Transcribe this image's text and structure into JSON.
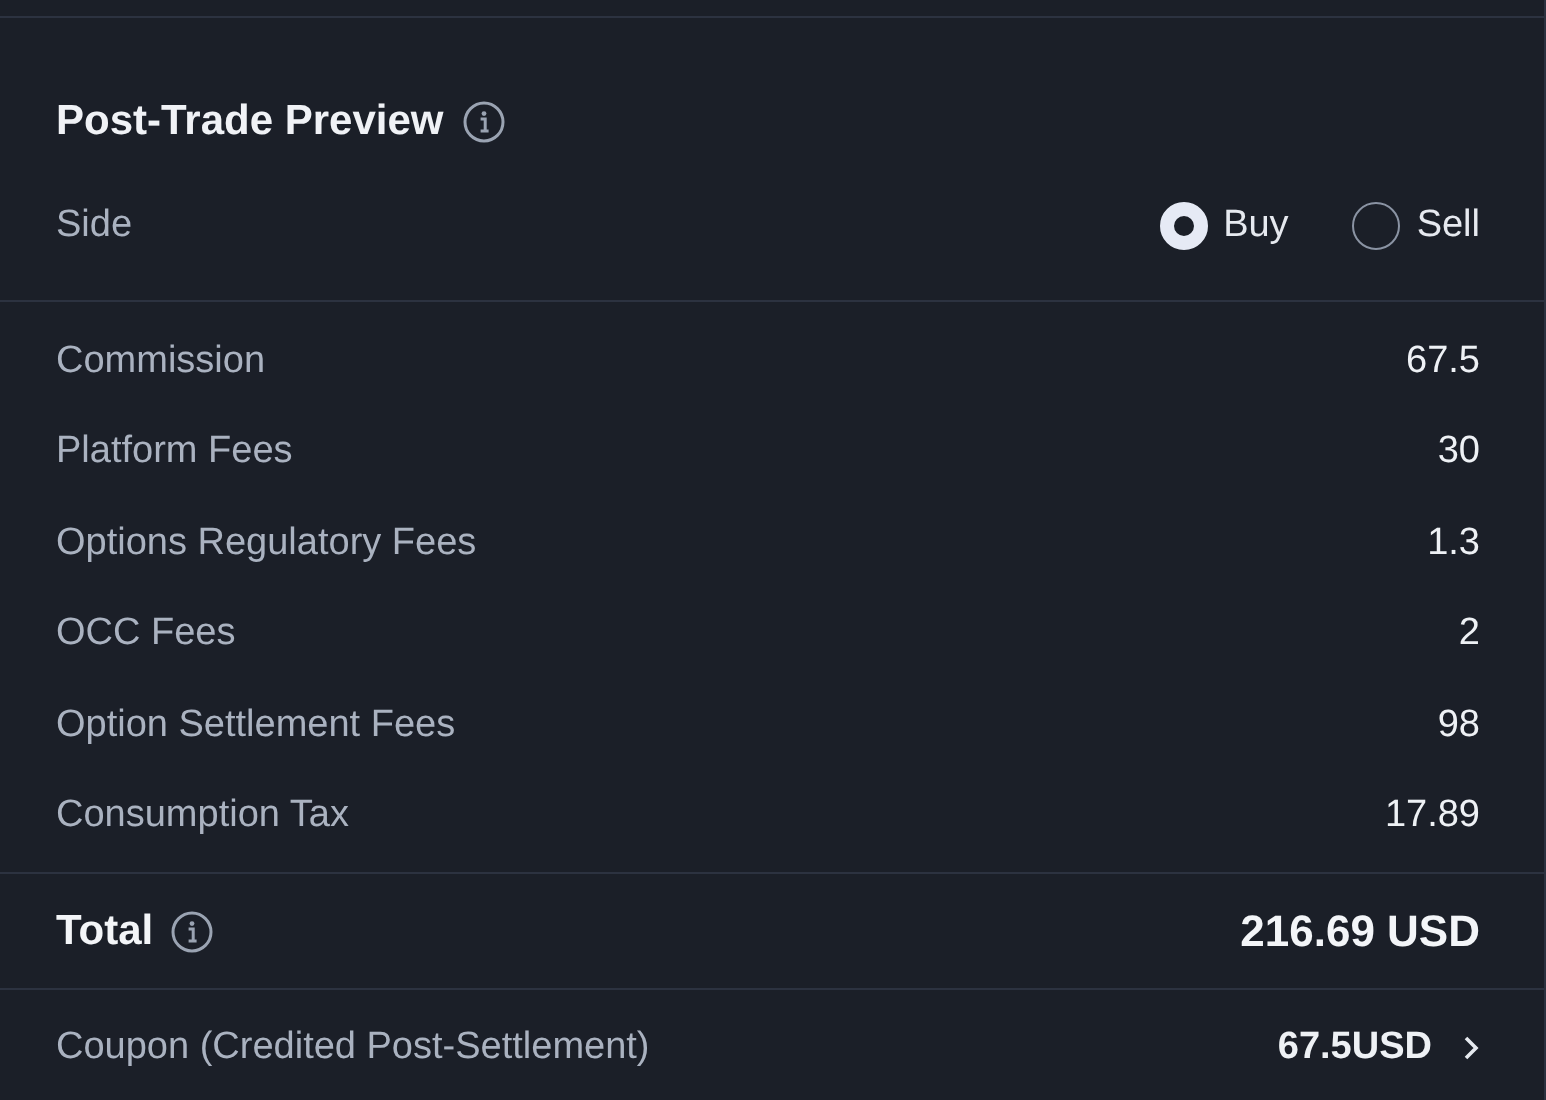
{
  "title": "Post-Trade Preview",
  "side": {
    "label": "Side",
    "options": [
      {
        "label": "Buy",
        "selected": true
      },
      {
        "label": "Sell",
        "selected": false
      }
    ]
  },
  "fees": [
    {
      "label": "Commission",
      "value": "67.5"
    },
    {
      "label": "Platform Fees",
      "value": "30"
    },
    {
      "label": "Options Regulatory Fees",
      "value": "1.3"
    },
    {
      "label": "OCC Fees",
      "value": "2"
    },
    {
      "label": "Option Settlement Fees",
      "value": "98"
    },
    {
      "label": "Consumption Tax",
      "value": "17.89"
    }
  ],
  "total": {
    "label": "Total",
    "value": "216.69 USD"
  },
  "coupon": {
    "label": "Coupon (Credited Post-Settlement)",
    "value": "67.5USD"
  }
}
